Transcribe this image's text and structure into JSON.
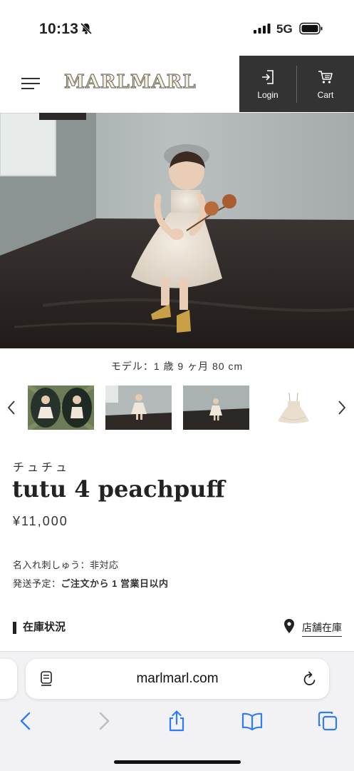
{
  "status_bar": {
    "time": "10:13",
    "network": "5G"
  },
  "header": {
    "logo": "MARLMARL",
    "login_label": "Login",
    "cart_label": "Cart"
  },
  "hero": {
    "caption": "モデル：1 歳 9 ヶ月 80 cm"
  },
  "product": {
    "category": "チュチュ",
    "title": "tutu 4 peachpuff",
    "price": "¥11,000",
    "embroidery_label": "名入れ刺しゅう：",
    "embroidery_value": "非対応",
    "shipping_label": "発送予定：",
    "shipping_value": "ご注文から 1 営業日以内"
  },
  "stock": {
    "heading": "在庫状況",
    "store_link": "店舗在庫"
  },
  "browser": {
    "url": "marlmarl.com"
  },
  "colors": {
    "header_dark": "#333333",
    "accent_blue": "#2f7cf6"
  }
}
